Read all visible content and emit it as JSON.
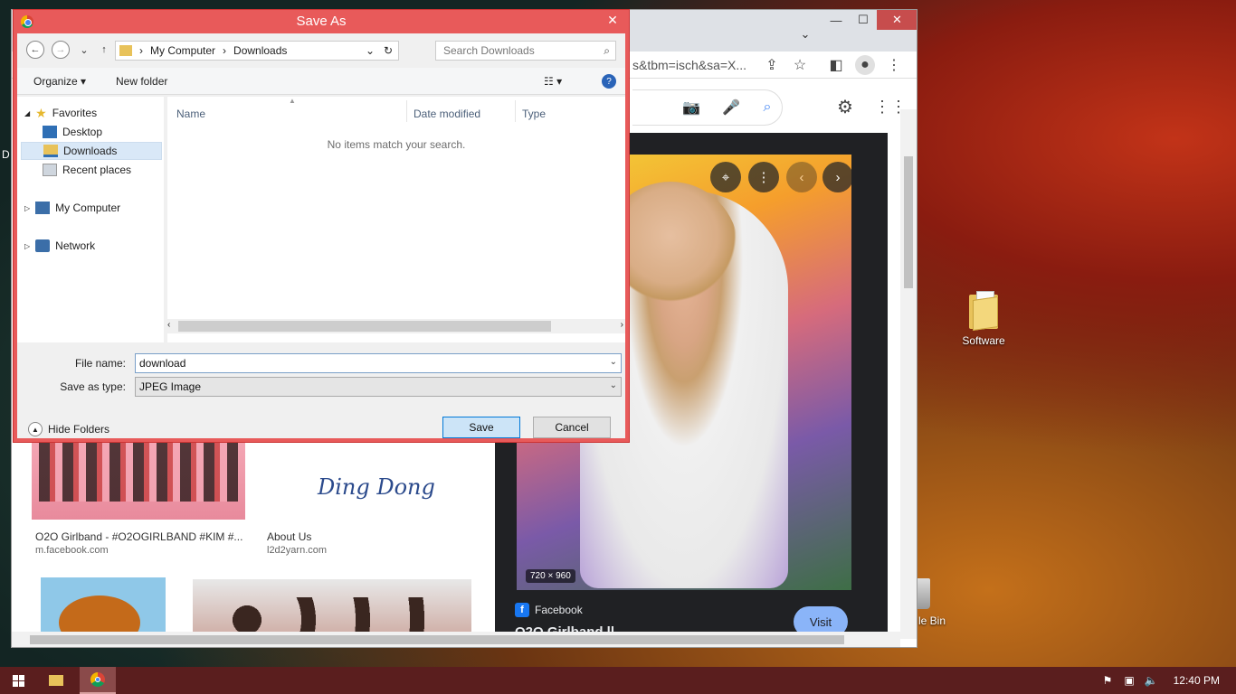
{
  "desktop": {
    "software_label": "Software",
    "recycle_label": "le Bin",
    "left_edge_char": "D"
  },
  "browser": {
    "url": "s&tbm=isch&sa=X...",
    "left_results": [
      {
        "title": "O2O Girlband - #O2OGIRLBAND #KIM #...",
        "site": "m.facebook.com"
      },
      {
        "title": "About Us",
        "site": "l2d2yarn.com"
      }
    ],
    "ding_dong_text": "Ding Dong",
    "preview": {
      "size_badge": "720 × 960",
      "source": "Facebook",
      "source_icon_letter": "f",
      "visit_label": "Visit",
      "title_partial": "O2O Girlband ll..."
    }
  },
  "dialog": {
    "title": "Save As",
    "breadcrumb": [
      "My Computer",
      "Downloads"
    ],
    "search_placeholder": "Search Downloads",
    "toolbar": {
      "organize": "Organize",
      "new_folder": "New folder"
    },
    "nav": [
      {
        "label": "Favorites",
        "selected": false
      },
      {
        "label": "Desktop",
        "selected": false
      },
      {
        "label": "Downloads",
        "selected": true
      },
      {
        "label": "Recent places",
        "selected": false
      },
      {
        "label": "My Computer",
        "selected": false
      },
      {
        "label": "Network",
        "selected": false
      }
    ],
    "columns": [
      "Name",
      "Date modified",
      "Type"
    ],
    "empty_message": "No items match your search.",
    "file_name_label": "File name:",
    "file_name_value": "download",
    "save_type_label": "Save as type:",
    "save_type_value": "JPEG Image",
    "hide_folders": "Hide Folders",
    "save_button": "Save",
    "cancel_button": "Cancel"
  },
  "taskbar": {
    "time": "12:40 PM"
  },
  "colors": {
    "dialog_border": "#e85a5a",
    "taskbar": "#5a1e1e",
    "preview_bg": "#202124",
    "visit": "#8ab4f8"
  }
}
